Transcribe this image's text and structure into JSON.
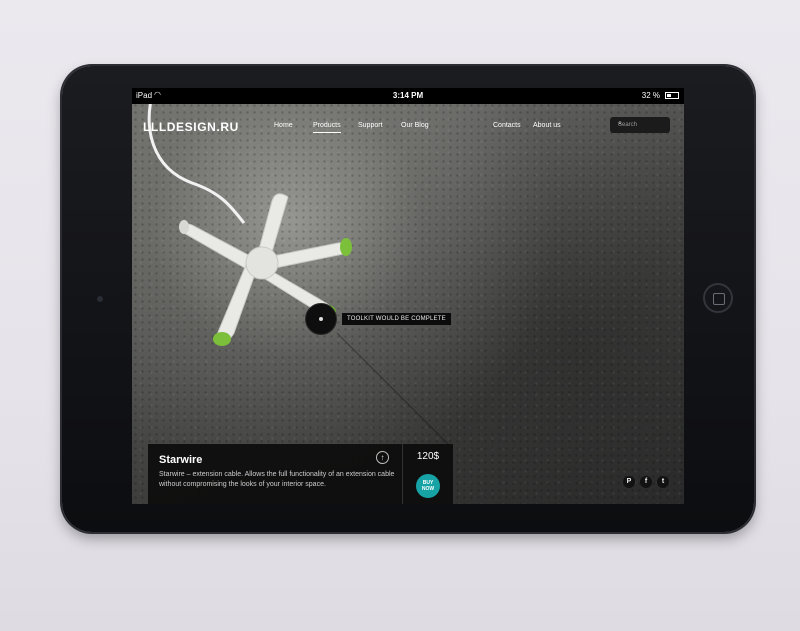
{
  "status_bar": {
    "carrier": "iPad",
    "time": "3:14 PM",
    "battery": "32 %"
  },
  "header": {
    "logo": "LLLDESIGN.RU",
    "nav": [
      {
        "label": "Home"
      },
      {
        "label": "Products",
        "active": true
      },
      {
        "label": "Support"
      },
      {
        "label": "Our Blog"
      },
      {
        "label": "Contacts"
      },
      {
        "label": "About us"
      }
    ],
    "search_placeholder": "Search"
  },
  "hero": {
    "tooltip": "TOOLKIT WOULD BE COMPLETE"
  },
  "product": {
    "title": "Starwire",
    "description": "Starwire – extension cable. Allows the full functionality of an extension cable without compromising the looks of your interior space.",
    "price": "120$",
    "buy_label_1": "BUY",
    "buy_label_2": "NOW"
  },
  "social": [
    {
      "icon": "pinterest-icon",
      "glyph": "P"
    },
    {
      "icon": "facebook-icon",
      "glyph": "f"
    },
    {
      "icon": "twitter-icon",
      "glyph": "t"
    }
  ],
  "colors": {
    "accent": "#17a3a5",
    "card_bg": "#0c0c0c"
  }
}
